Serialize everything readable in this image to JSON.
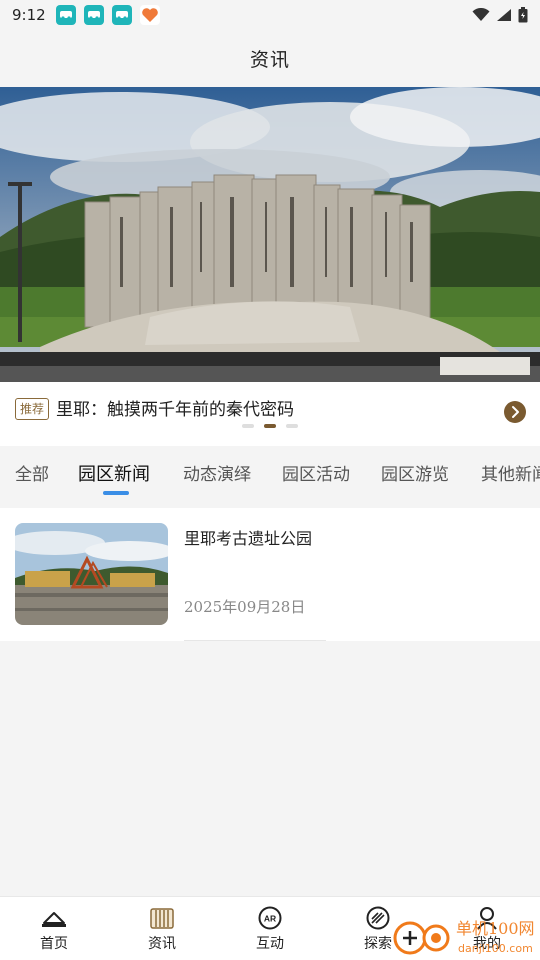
{
  "status_bar": {
    "time": "9:12"
  },
  "header": {
    "title": "资讯"
  },
  "banner": {
    "recommend_badge": "推荐",
    "recommend_title": "里耶：触摸两千年前的秦代密码",
    "page_count": 3,
    "active_page": 2
  },
  "tabs": [
    {
      "label": "全部"
    },
    {
      "label": "园区新闻"
    },
    {
      "label": "动态演绎"
    },
    {
      "label": "园区活动"
    },
    {
      "label": "园区游览"
    },
    {
      "label": "其他新闻"
    }
  ],
  "active_tab": 1,
  "news": [
    {
      "title": "里耶考古遗址公园",
      "date": "2025年09月28日"
    }
  ],
  "bottom_nav": [
    {
      "label": "首页",
      "icon": "home-icon"
    },
    {
      "label": "资讯",
      "icon": "news-icon"
    },
    {
      "label": "互动",
      "icon": "ar-icon"
    },
    {
      "label": "探索",
      "icon": "explore-icon"
    },
    {
      "label": "我的",
      "icon": "profile-icon"
    }
  ],
  "watermark": {
    "text": "单机100网",
    "url_text": "danji100.com"
  },
  "colors": {
    "accent": "#3a8ee6",
    "brand_brown": "#7a5a30",
    "background": "#f4f4f4"
  }
}
